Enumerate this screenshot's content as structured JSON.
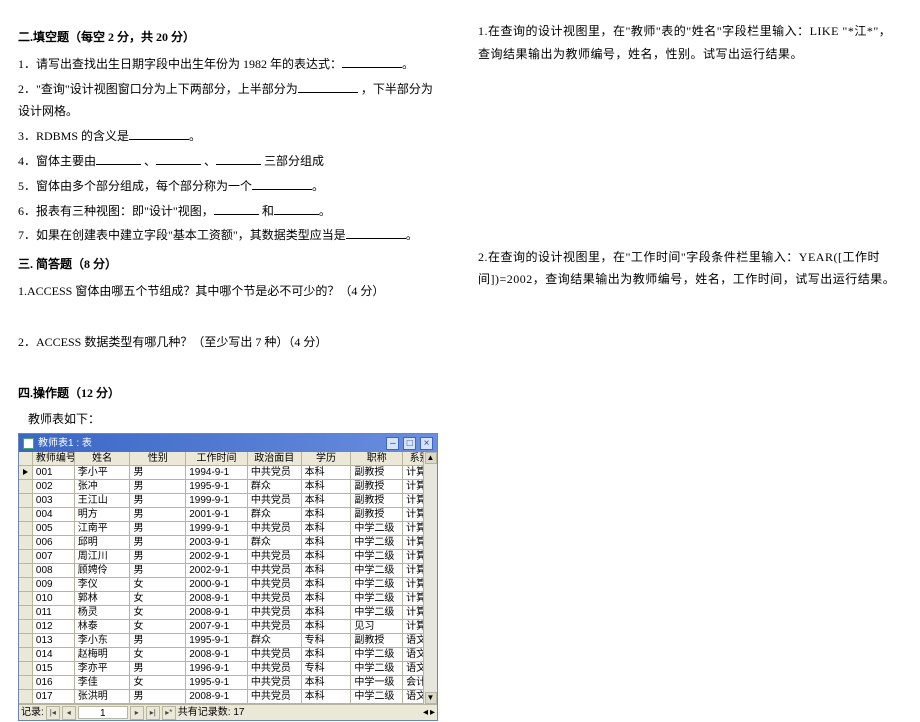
{
  "left": {
    "sec2_title": "二.填空题（每空 2 分，共 20 分）",
    "q1": "1．请写出查找出生日期字段中出生年份为 1982 年的表达式：",
    "q2a": "2．\"查询\"设计视图窗口分为上下两部分，上半部分为",
    "q2b": " ，下半部分为设计网格。",
    "q3a": "3．RDBMS 的含义是",
    "q4a": "4．窗体主要由",
    "q4b": "、",
    "q4c": "、",
    "q4d": "三部分组成",
    "q5a": "5．窗体由多个部分组成，每个部分称为一个",
    "q6a": "6．报表有三种视图：即\"设计\"视图，",
    "q6b": "和",
    "q7a": "7．如果在创建表中建立字段\"基本工资额\"，其数据类型应当是",
    "sec3_title": "三. 简答题（8 分）",
    "sa1": "1.ACCESS 窗体由哪五个节组成？其中哪个节是必不可少的？（4 分）",
    "sa2": "2．ACCESS 数据类型有哪几种？（至少写出 7 种）（4 分）",
    "sec4_title": "四.操作题（12 分）",
    "sec4_sub": "教师表如下："
  },
  "table": {
    "title": "教师表1 : 表",
    "headers": [
      "教师编号",
      "姓名",
      "性别",
      "工作时间",
      "政治面目",
      "学历",
      "职称",
      "系别"
    ],
    "rows": [
      [
        "001",
        "李小平",
        "男",
        "1994-9-1",
        "中共党员",
        "本科",
        "副教授",
        "计算机"
      ],
      [
        "002",
        "张冲",
        "男",
        "1995-9-1",
        "群众",
        "本科",
        "副教授",
        "计算机"
      ],
      [
        "003",
        "王江山",
        "男",
        "1999-9-1",
        "中共党员",
        "本科",
        "副教授",
        "计算机"
      ],
      [
        "004",
        "明方",
        "男",
        "2001-9-1",
        "群众",
        "本科",
        "副教授",
        "计算机"
      ],
      [
        "005",
        "江南平",
        "男",
        "1999-9-1",
        "中共党员",
        "本科",
        "中学二级",
        "计算机"
      ],
      [
        "006",
        "邱明",
        "男",
        "2003-9-1",
        "群众",
        "本科",
        "中学二级",
        "计算机"
      ],
      [
        "007",
        "周江川",
        "男",
        "2002-9-1",
        "中共党员",
        "本科",
        "中学二级",
        "计算机"
      ],
      [
        "008",
        "顾娉伶",
        "男",
        "2002-9-1",
        "中共党员",
        "本科",
        "中学二级",
        "计算机"
      ],
      [
        "009",
        "李仪",
        "女",
        "2000-9-1",
        "中共党员",
        "本科",
        "中学二级",
        "计算机"
      ],
      [
        "010",
        "郭林",
        "女",
        "2008-9-1",
        "中共党员",
        "本科",
        "中学二级",
        "计算机"
      ],
      [
        "011",
        "杨灵",
        "女",
        "2008-9-1",
        "中共党员",
        "本科",
        "中学二级",
        "计算机"
      ],
      [
        "012",
        "林泰",
        "女",
        "2007-9-1",
        "中共党员",
        "本科",
        "见习",
        "计算机"
      ],
      [
        "013",
        "李小东",
        "男",
        "1995-9-1",
        "群众",
        "专科",
        "副教授",
        "语文"
      ],
      [
        "014",
        "赵梅明",
        "女",
        "2008-9-1",
        "中共党员",
        "本科",
        "中学二级",
        "语文"
      ],
      [
        "015",
        "李亦平",
        "男",
        "1996-9-1",
        "中共党员",
        "专科",
        "中学二级",
        "语文"
      ],
      [
        "016",
        "李佳",
        "女",
        "1995-9-1",
        "中共党员",
        "本科",
        "中学一级",
        "会计"
      ],
      [
        "017",
        "张洪明",
        "男",
        "2008-9-1",
        "中共党员",
        "本科",
        "中学二级",
        "语文"
      ]
    ],
    "nav_label": "记录:",
    "nav_current": "1",
    "nav_total": "共有记录数: 17"
  },
  "right": {
    "q1": "1.在查询的设计视图里，在\"教师\"表的\"姓名\"字段栏里输入：LIKE \"*江*\"，查询结果输出为教师编号，姓名，性别。试写出运行结果。",
    "q2": "2.在查询的设计视图里，在\"工作时间\"字段条件栏里输入：YEAR([工作时间])=2002，查询结果输出为教师编号，姓名，工作时间，试写出运行结果。"
  }
}
